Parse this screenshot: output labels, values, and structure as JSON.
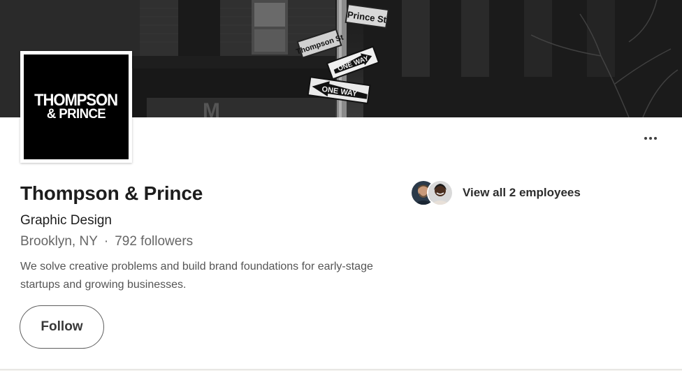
{
  "cover": {
    "street_sign_1": "Prince St",
    "street_sign_2": "Thompson St",
    "one_way_sign_1": "ONE WAY",
    "one_way_sign_2": "ONE WAY"
  },
  "logo": {
    "line1": "THOMPSON",
    "line2": "& PRINCE"
  },
  "company": {
    "name": "Thompson & Prince",
    "industry": "Graphic Design",
    "location": "Brooklyn, NY",
    "separator": "·",
    "followers": "792 followers",
    "tagline": "We solve creative problems and build brand foundations for early-stage startups and growing businesses."
  },
  "actions": {
    "follow_label": "Follow",
    "more_icon": "more-horizontal-icon"
  },
  "employees": {
    "link_label": "View all 2 employees"
  },
  "colors": {
    "card_background": "#ffffff",
    "page_background": "#f3f2ef",
    "text_primary": "#1d1d1d",
    "text_secondary": "#666666",
    "logo_background": "#000000"
  }
}
